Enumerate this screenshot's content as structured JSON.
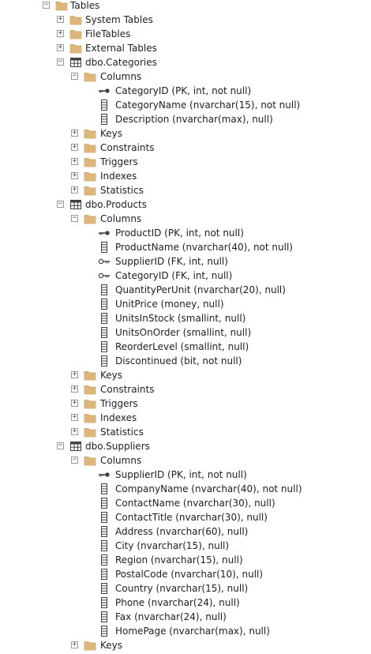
{
  "tree": [
    {
      "level": 0,
      "icon": "folder",
      "expander": "collapse",
      "label": "Tables"
    },
    {
      "level": 1,
      "icon": "folder",
      "expander": "expand",
      "label": "System Tables"
    },
    {
      "level": 1,
      "icon": "folder",
      "expander": "expand",
      "label": "FileTables"
    },
    {
      "level": 1,
      "icon": "folder",
      "expander": "expand",
      "label": "External Tables"
    },
    {
      "level": 1,
      "icon": "table",
      "expander": "collapse",
      "label": "dbo.Categories"
    },
    {
      "level": 2,
      "icon": "folder",
      "expander": "collapse",
      "label": "Columns"
    },
    {
      "level": 3,
      "icon": "primary-key",
      "expander": "none",
      "label": "CategoryID (PK, int, not null)"
    },
    {
      "level": 3,
      "icon": "column",
      "expander": "none",
      "label": "CategoryName (nvarchar(15), not null)"
    },
    {
      "level": 3,
      "icon": "column",
      "expander": "none",
      "label": "Description (nvarchar(max), null)"
    },
    {
      "level": 2,
      "icon": "folder",
      "expander": "expand",
      "label": "Keys"
    },
    {
      "level": 2,
      "icon": "folder",
      "expander": "expand",
      "label": "Constraints"
    },
    {
      "level": 2,
      "icon": "folder",
      "expander": "expand",
      "label": "Triggers"
    },
    {
      "level": 2,
      "icon": "folder",
      "expander": "expand",
      "label": "Indexes"
    },
    {
      "level": 2,
      "icon": "folder",
      "expander": "expand",
      "label": "Statistics"
    },
    {
      "level": 1,
      "icon": "table",
      "expander": "collapse",
      "label": "dbo.Products"
    },
    {
      "level": 2,
      "icon": "folder",
      "expander": "collapse",
      "label": "Columns"
    },
    {
      "level": 3,
      "icon": "primary-key",
      "expander": "none",
      "label": "ProductID (PK, int, not null)"
    },
    {
      "level": 3,
      "icon": "column",
      "expander": "none",
      "label": "ProductName (nvarchar(40), not null)"
    },
    {
      "level": 3,
      "icon": "foreign-key",
      "expander": "none",
      "label": "SupplierID (FK, int, null)"
    },
    {
      "level": 3,
      "icon": "foreign-key",
      "expander": "none",
      "label": "CategoryID (FK, int, null)"
    },
    {
      "level": 3,
      "icon": "column",
      "expander": "none",
      "label": "QuantityPerUnit (nvarchar(20), null)"
    },
    {
      "level": 3,
      "icon": "column",
      "expander": "none",
      "label": "UnitPrice (money, null)"
    },
    {
      "level": 3,
      "icon": "column",
      "expander": "none",
      "label": "UnitsInStock (smallint, null)"
    },
    {
      "level": 3,
      "icon": "column",
      "expander": "none",
      "label": "UnitsOnOrder (smallint, null)"
    },
    {
      "level": 3,
      "icon": "column",
      "expander": "none",
      "label": "ReorderLevel (smallint, null)"
    },
    {
      "level": 3,
      "icon": "column",
      "expander": "none",
      "label": "Discontinued (bit, not null)"
    },
    {
      "level": 2,
      "icon": "folder",
      "expander": "expand",
      "label": "Keys"
    },
    {
      "level": 2,
      "icon": "folder",
      "expander": "expand",
      "label": "Constraints"
    },
    {
      "level": 2,
      "icon": "folder",
      "expander": "expand",
      "label": "Triggers"
    },
    {
      "level": 2,
      "icon": "folder",
      "expander": "expand",
      "label": "Indexes"
    },
    {
      "level": 2,
      "icon": "folder",
      "expander": "expand",
      "label": "Statistics"
    },
    {
      "level": 1,
      "icon": "table",
      "expander": "collapse",
      "label": "dbo.Suppliers"
    },
    {
      "level": 2,
      "icon": "folder",
      "expander": "collapse",
      "label": "Columns"
    },
    {
      "level": 3,
      "icon": "primary-key",
      "expander": "none",
      "label": "SupplierID (PK, int, not null)"
    },
    {
      "level": 3,
      "icon": "column",
      "expander": "none",
      "label": "CompanyName (nvarchar(40), not null)"
    },
    {
      "level": 3,
      "icon": "column",
      "expander": "none",
      "label": "ContactName (nvarchar(30), null)"
    },
    {
      "level": 3,
      "icon": "column",
      "expander": "none",
      "label": "ContactTitle (nvarchar(30), null)"
    },
    {
      "level": 3,
      "icon": "column",
      "expander": "none",
      "label": "Address (nvarchar(60), null)"
    },
    {
      "level": 3,
      "icon": "column",
      "expander": "none",
      "label": "City (nvarchar(15), null)"
    },
    {
      "level": 3,
      "icon": "column",
      "expander": "none",
      "label": "Region (nvarchar(15), null)"
    },
    {
      "level": 3,
      "icon": "column",
      "expander": "none",
      "label": "PostalCode (nvarchar(10), null)"
    },
    {
      "level": 3,
      "icon": "column",
      "expander": "none",
      "label": "Country (nvarchar(15), null)"
    },
    {
      "level": 3,
      "icon": "column",
      "expander": "none",
      "label": "Phone (nvarchar(24), null)"
    },
    {
      "level": 3,
      "icon": "column",
      "expander": "none",
      "label": "Fax (nvarchar(24), null)"
    },
    {
      "level": 3,
      "icon": "column",
      "expander": "none",
      "label": "HomePage (nvarchar(max), null)"
    },
    {
      "level": 2,
      "icon": "folder",
      "expander": "expand",
      "label": "Keys"
    }
  ],
  "colors": {
    "folder": "#DCB67A",
    "folder_dark": "#C9A25F",
    "icon_stroke": "#424242",
    "expander_border": "#999999"
  }
}
